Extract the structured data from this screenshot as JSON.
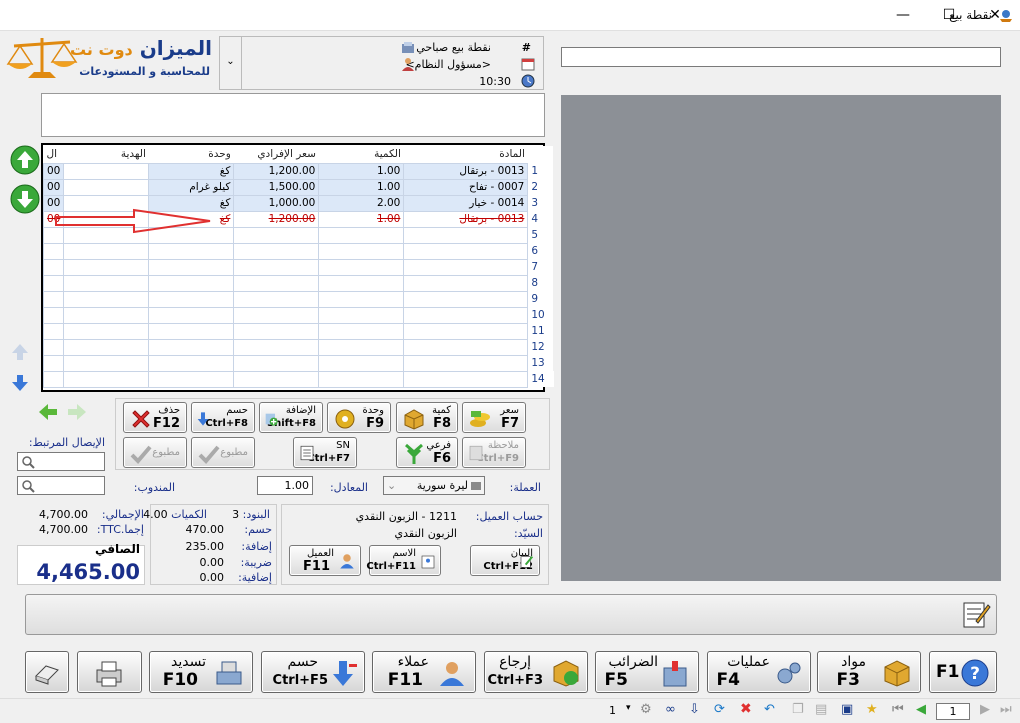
{
  "window": {
    "title": "نقطة بيع",
    "minimize": "—",
    "maximize": "☐",
    "close": "✕"
  },
  "logo": {
    "line1": "الميزان",
    "line2": "دوت نت",
    "tagline": "للمحاسبة و المستودعات"
  },
  "header": {
    "hash_label": "#",
    "pos_name": "نقطة بيع صباحي",
    "user": "<مسؤول النظام>",
    "time": "10:30"
  },
  "grid": {
    "columns": {
      "item": "المادة",
      "qty": "الكمية",
      "price": "سعر الإفرادي",
      "unit": "وحدة",
      "gift": "الهدية",
      "extra": "ال"
    },
    "rows": [
      {
        "n": "1",
        "item": "0013 - برتقال",
        "qty": "1.00",
        "price": "1,200.00",
        "unit": "كغ",
        "gift": "",
        "extra": "00"
      },
      {
        "n": "2",
        "item": "0007 - تفاح",
        "qty": "1.00",
        "price": "1,500.00",
        "unit": "كيلو غرام",
        "gift": "",
        "extra": "00"
      },
      {
        "n": "3",
        "item": "0014 - خيار",
        "qty": "2.00",
        "price": "1,000.00",
        "unit": "كغ",
        "gift": "",
        "extra": "00"
      },
      {
        "n": "4",
        "item": "0013 - برتقال",
        "qty": "1.00",
        "price": "1,200.00",
        "unit": "كغ",
        "gift": "",
        "extra": "00"
      },
      {
        "n": "5"
      },
      {
        "n": "6"
      },
      {
        "n": "7"
      },
      {
        "n": "8"
      },
      {
        "n": "9"
      },
      {
        "n": "10"
      },
      {
        "n": "11"
      },
      {
        "n": "12"
      },
      {
        "n": "13"
      },
      {
        "n": "14"
      }
    ]
  },
  "actions": {
    "price": {
      "label": "سعر",
      "key": "F7"
    },
    "qty": {
      "label": "كمية",
      "key": "F8"
    },
    "unit": {
      "label": "وحدة",
      "key": "F9"
    },
    "add": {
      "label": "الإضافة",
      "key": "Shift+F8"
    },
    "discount": {
      "label": "حسم",
      "key": "Ctrl+F8"
    },
    "delete": {
      "label": "حذف",
      "key": "F12"
    },
    "note": {
      "label": "ملاحظة",
      "key": "Ctrl+F9"
    },
    "branch": {
      "label": "فرعي",
      "key": "F6"
    },
    "sn": {
      "label": "SN",
      "key": "Ctrl+F7"
    },
    "printed1": {
      "label": "مطبوع"
    },
    "printed2": {
      "label": "مطبوع"
    }
  },
  "linked_receipt": {
    "label": "الإيصال المرتبط:"
  },
  "delegate": {
    "label": "المندوب:"
  },
  "currency": {
    "label": "العملة:",
    "value": "ليرة سورية",
    "rate_label": "المعادل:",
    "rate": "1.00"
  },
  "customer": {
    "account_label": "حساب العميل:",
    "account": "1211 - الزبون النقدي",
    "mr_label": "السيّد:",
    "mr": "الزبون النقدي",
    "statement": {
      "label": "البيان",
      "key": "Ctrl+F12"
    },
    "name": {
      "label": "الاسم",
      "key": "Ctrl+F11"
    },
    "client": {
      "label": "العميل",
      "key": "F11"
    }
  },
  "stats": {
    "items_label": "البنود:",
    "items": "3",
    "qtys_label": "الكميات",
    "qtys": "4.00",
    "discount_label": "حسم:",
    "discount": "470.00",
    "addition_label": "إضافة:",
    "addition": "235.00",
    "tax_label": "ضريبة:",
    "tax": "0.00",
    "extra_label": "إضافية:",
    "extra": "0.00"
  },
  "totals": {
    "total_label": "الإجمالي:",
    "total": "4,700.00",
    "ttc_label": "إجما.TTC:",
    "ttc": "4,700.00",
    "net_label": "الصافي",
    "net": "4,465.00"
  },
  "bottom": {
    "f1": {
      "key": "F1"
    },
    "items": {
      "label": "مواد",
      "key": "F3"
    },
    "ops": {
      "label": "عمليات",
      "key": "F4"
    },
    "taxes": {
      "label": "الضرائب",
      "key": "F5"
    },
    "return": {
      "label": "إرجاع",
      "key": "Ctrl+F3"
    },
    "customers": {
      "label": "عملاء",
      "key": "F11"
    },
    "discount": {
      "label": "حسم",
      "key": "Ctrl+F5"
    },
    "pay": {
      "label": "تسديد",
      "key": "F10"
    }
  },
  "statusbar": {
    "page": "1",
    "page_left": "1"
  },
  "colors": {
    "accent": "#1a2f8a",
    "brand": "#1a3c8a",
    "deleted": "#c00000",
    "arrow": "#e03030"
  }
}
